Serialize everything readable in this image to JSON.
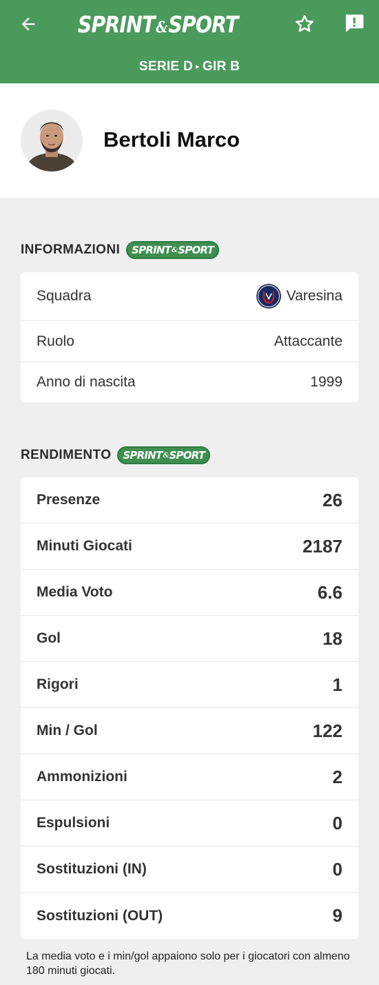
{
  "header": {
    "logo_main": "SPRINT",
    "logo_amp": "&",
    "logo_end": "SPORT",
    "league": "SERIE D",
    "league_sep": "▸",
    "group": "GIR B",
    "back_icon": "arrow-left-icon",
    "star_icon": "star-outline-icon",
    "report_icon": "report-icon",
    "bg_color": "#4a9a5c"
  },
  "player": {
    "name": "Bertoli Marco"
  },
  "info": {
    "title": "INFORMAZIONI",
    "badge_main": "SPRINT",
    "badge_amp": "&",
    "badge_end": "SPORT",
    "rows": [
      {
        "label": "Squadra",
        "value": "Varesina"
      },
      {
        "label": "Ruolo",
        "value": "Attaccante"
      },
      {
        "label": "Anno di nascita",
        "value": "1999"
      }
    ]
  },
  "stats": {
    "title": "RENDIMENTO",
    "badge_main": "SPRINT",
    "badge_amp": "&",
    "badge_end": "SPORT",
    "rows": [
      {
        "label": "Presenze",
        "value": "26"
      },
      {
        "label": "Minuti Giocati",
        "value": "2187"
      },
      {
        "label": "Media Voto",
        "value": "6.6"
      },
      {
        "label": "Gol",
        "value": "18"
      },
      {
        "label": "Rigori",
        "value": "1"
      },
      {
        "label": "Min / Gol",
        "value": "122"
      },
      {
        "label": "Ammonizioni",
        "value": "2"
      },
      {
        "label": "Espulsioni",
        "value": "0"
      },
      {
        "label": "Sostituzioni (IN)",
        "value": "0"
      },
      {
        "label": "Sostituzioni (OUT)",
        "value": "9"
      }
    ]
  },
  "footnote": "La media voto e i min/gol appaiono solo per i giocatori con almeno 180 minuti giocati."
}
